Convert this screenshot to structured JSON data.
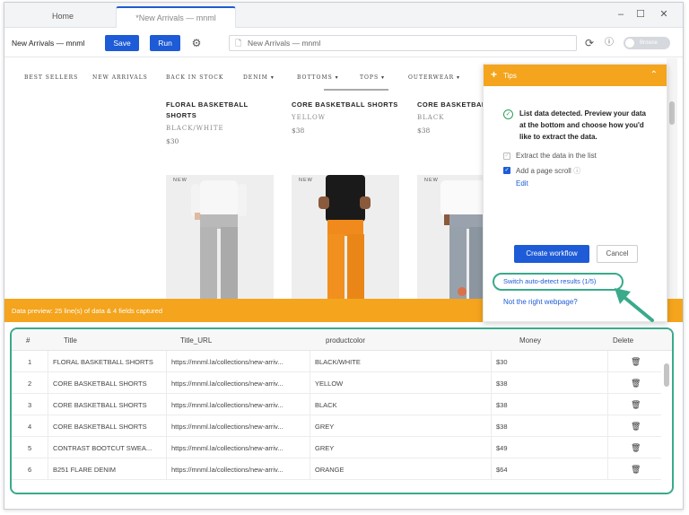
{
  "titlebar": {
    "tabs": [
      "Home",
      "*New Arrivals — mnml"
    ],
    "controls": {
      "minimize": "–",
      "maximize": "☐",
      "close": "✕"
    }
  },
  "toolbar": {
    "task_name": "New Arrivals — mnml",
    "save_label": "Save",
    "run_label": "Run",
    "url": "New Arrivals — mnml",
    "toggle_label": "Browse"
  },
  "site": {
    "nav": [
      "BEST SELLERS",
      "NEW ARRIVALS",
      "BACK IN STOCK",
      "DENIM ▾",
      "BOTTOMS ▾",
      "TOPS ▾",
      "OUTERWEAR ▾"
    ],
    "products": [
      {
        "title": "FLORAL BASKETBALL SHORTS",
        "color": "BLACK/WHITE",
        "price": "$30",
        "badge": "NEW"
      },
      {
        "title": "CORE BASKETBALL SHORTS",
        "color": "YELLOW",
        "price": "$38",
        "badge": "NEW"
      },
      {
        "title": "CORE BASKETBALL SHORTS",
        "color": "BLACK",
        "price": "$38",
        "badge": "NEW"
      }
    ]
  },
  "banner": {
    "text": "Data preview: 25 line(s) of data & 4 fields captured"
  },
  "tips": {
    "title": "Tips",
    "message": "List data detected. Preview your data at the bottom and choose how you'd like to extract the data.",
    "options": [
      {
        "label": "Extract the data in the list",
        "checked": false
      },
      {
        "label": "Add a page scroll",
        "checked": true
      }
    ],
    "edit_label": "Edit",
    "create_label": "Create workflow",
    "cancel_label": "Cancel",
    "switch_label": "Switch auto-detect results (1/5)",
    "wrong_page_label": "Not the right webpage?"
  },
  "table": {
    "headers": [
      "#",
      "Title",
      "Title_URL",
      "productcolor",
      "Money",
      "Delete"
    ],
    "rows": [
      {
        "num": "1",
        "title": "FLORAL BASKETBALL SHORTS",
        "url": "https://mnml.la/collections/new-arriv...",
        "color": "BLACK/WHITE",
        "money": "$30"
      },
      {
        "num": "2",
        "title": "CORE BASKETBALL SHORTS",
        "url": "https://mnml.la/collections/new-arriv...",
        "color": "YELLOW",
        "money": "$38"
      },
      {
        "num": "3",
        "title": "CORE BASKETBALL SHORTS",
        "url": "https://mnml.la/collections/new-arriv...",
        "color": "BLACK",
        "money": "$38"
      },
      {
        "num": "4",
        "title": "CORE BASKETBALL SHORTS",
        "url": "https://mnml.la/collections/new-arriv...",
        "color": "GREY",
        "money": "$38"
      },
      {
        "num": "5",
        "title": "CONTRAST BOOTCUT SWEA...",
        "url": "https://mnml.la/collections/new-arriv...",
        "color": "GREY",
        "money": "$49"
      },
      {
        "num": "6",
        "title": "B251 FLARE DENIM",
        "url": "https://mnml.la/collections/new-arriv...",
        "color": "ORANGE",
        "money": "$64"
      }
    ]
  },
  "colors": {
    "accent": "#1e5bd6",
    "banner": "#f4a41d",
    "highlight": "#3aaa8a"
  }
}
